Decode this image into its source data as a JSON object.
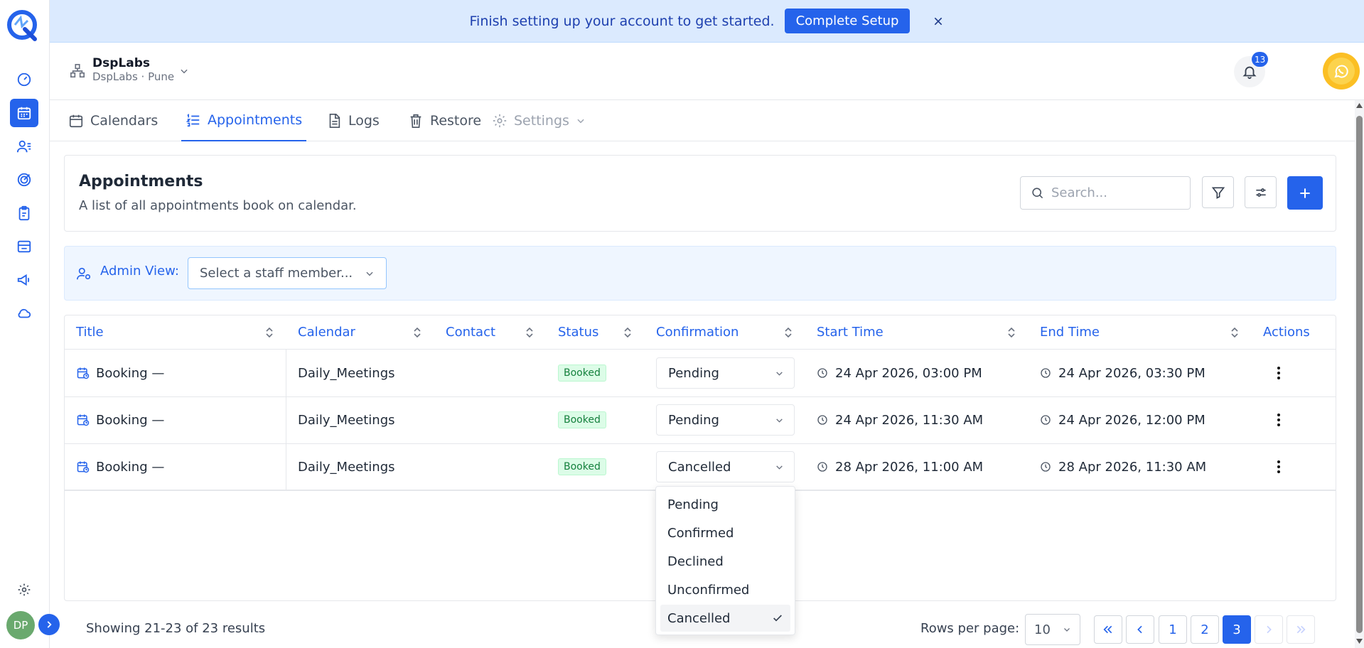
{
  "banner": {
    "message": "Finish setting up your account to get started.",
    "button": "Complete Setup"
  },
  "org": {
    "name": "DspLabs",
    "subtitle": "DspLabs · Pune"
  },
  "header": {
    "notifications_count": "13",
    "avatar": "DP"
  },
  "tabs": [
    {
      "label": "Calendars",
      "icon": "calendar-icon"
    },
    {
      "label": "Appointments",
      "icon": "list-icon"
    },
    {
      "label": "Logs",
      "icon": "document-icon"
    },
    {
      "label": "Restore",
      "icon": "trash-icon"
    },
    {
      "label": "Settings",
      "icon": "gear-icon"
    }
  ],
  "page": {
    "title": "Appointments",
    "description": "A list of all appointments book on calendar.",
    "search_placeholder": "Search..."
  },
  "admin": {
    "label": "Admin View:",
    "placeholder": "Select a staff member..."
  },
  "table": {
    "columns": [
      "Title",
      "Calendar",
      "Contact",
      "Status",
      "Confirmation",
      "Start Time",
      "End Time",
      "Actions"
    ],
    "rows": [
      {
        "title": "Booking —",
        "calendar": "Daily_Meetings",
        "contact": "",
        "status": "Booked",
        "confirmation": "Pending",
        "start": "24 Apr 2026, 03:00 PM",
        "end": "24 Apr 2026, 03:30 PM"
      },
      {
        "title": "Booking —",
        "calendar": "Daily_Meetings",
        "contact": "",
        "status": "Booked",
        "confirmation": "Pending",
        "start": "24 Apr 2026, 11:30 AM",
        "end": "24 Apr 2026, 12:00 PM"
      },
      {
        "title": "Booking —",
        "calendar": "Daily_Meetings",
        "contact": "",
        "status": "Booked",
        "confirmation": "Cancelled",
        "start": "28 Apr 2026, 11:00 AM",
        "end": "28 Apr 2026, 11:30 AM"
      }
    ]
  },
  "dropdown": {
    "options": [
      "Pending",
      "Confirmed",
      "Declined",
      "Unconfirmed",
      "Cancelled"
    ],
    "selected": "Cancelled"
  },
  "footer": {
    "showing": "Showing 21-23 of 23 results",
    "rows_label": "Rows per page:",
    "rows_value": "10",
    "pages": [
      "1",
      "2",
      "3"
    ],
    "current_page": "3"
  },
  "sidebar": {
    "avatar": "DP"
  },
  "colors": {
    "accent": "#2563eb",
    "banner_bg": "#dbeafe",
    "badge_bg": "#dcfce7",
    "badge_text": "#15803d"
  }
}
